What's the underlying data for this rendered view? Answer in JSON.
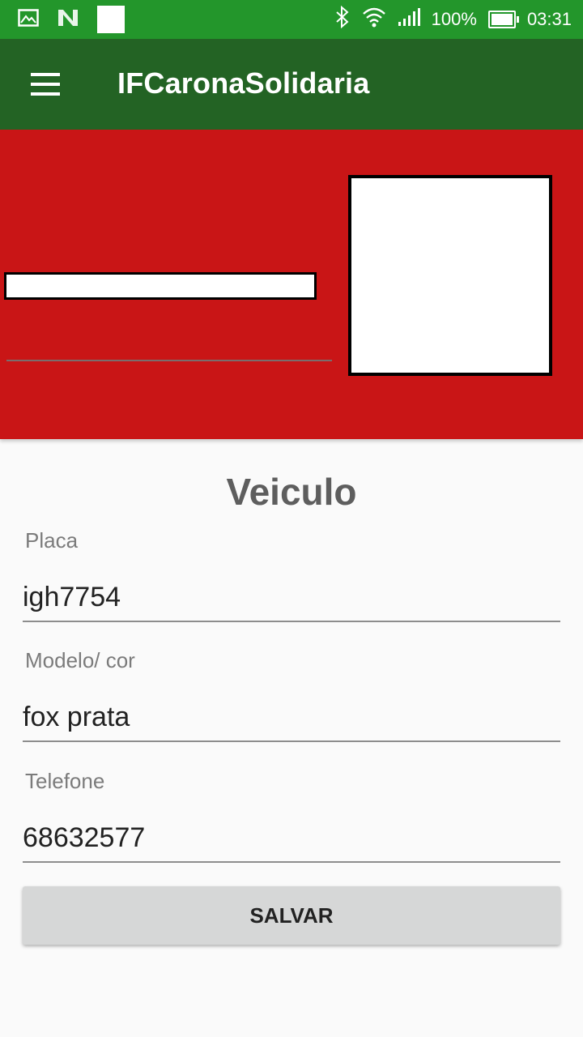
{
  "status_bar": {
    "icons": [
      "image-icon",
      "n-logo-icon",
      "bluetooth-icon",
      "wifi-icon",
      "signal-icon",
      "battery-icon"
    ],
    "battery": "100%",
    "time": "03:31"
  },
  "app_bar": {
    "title": "IFCaronaSolidaria",
    "menu_icon": "hamburger-menu-icon"
  },
  "header": {
    "background_color": "#c91516"
  },
  "form": {
    "title": "Veiculo",
    "fields": [
      {
        "label": "Placa",
        "value": "igh7754"
      },
      {
        "label": "Modelo/ cor",
        "value": "fox prata"
      },
      {
        "label": "Telefone",
        "value": "68632577"
      }
    ],
    "save_label": "SALVAR"
  },
  "colors": {
    "status_bar": "#23962b",
    "app_bar": "#236324",
    "header": "#c91516",
    "button": "#d6d7d7"
  }
}
